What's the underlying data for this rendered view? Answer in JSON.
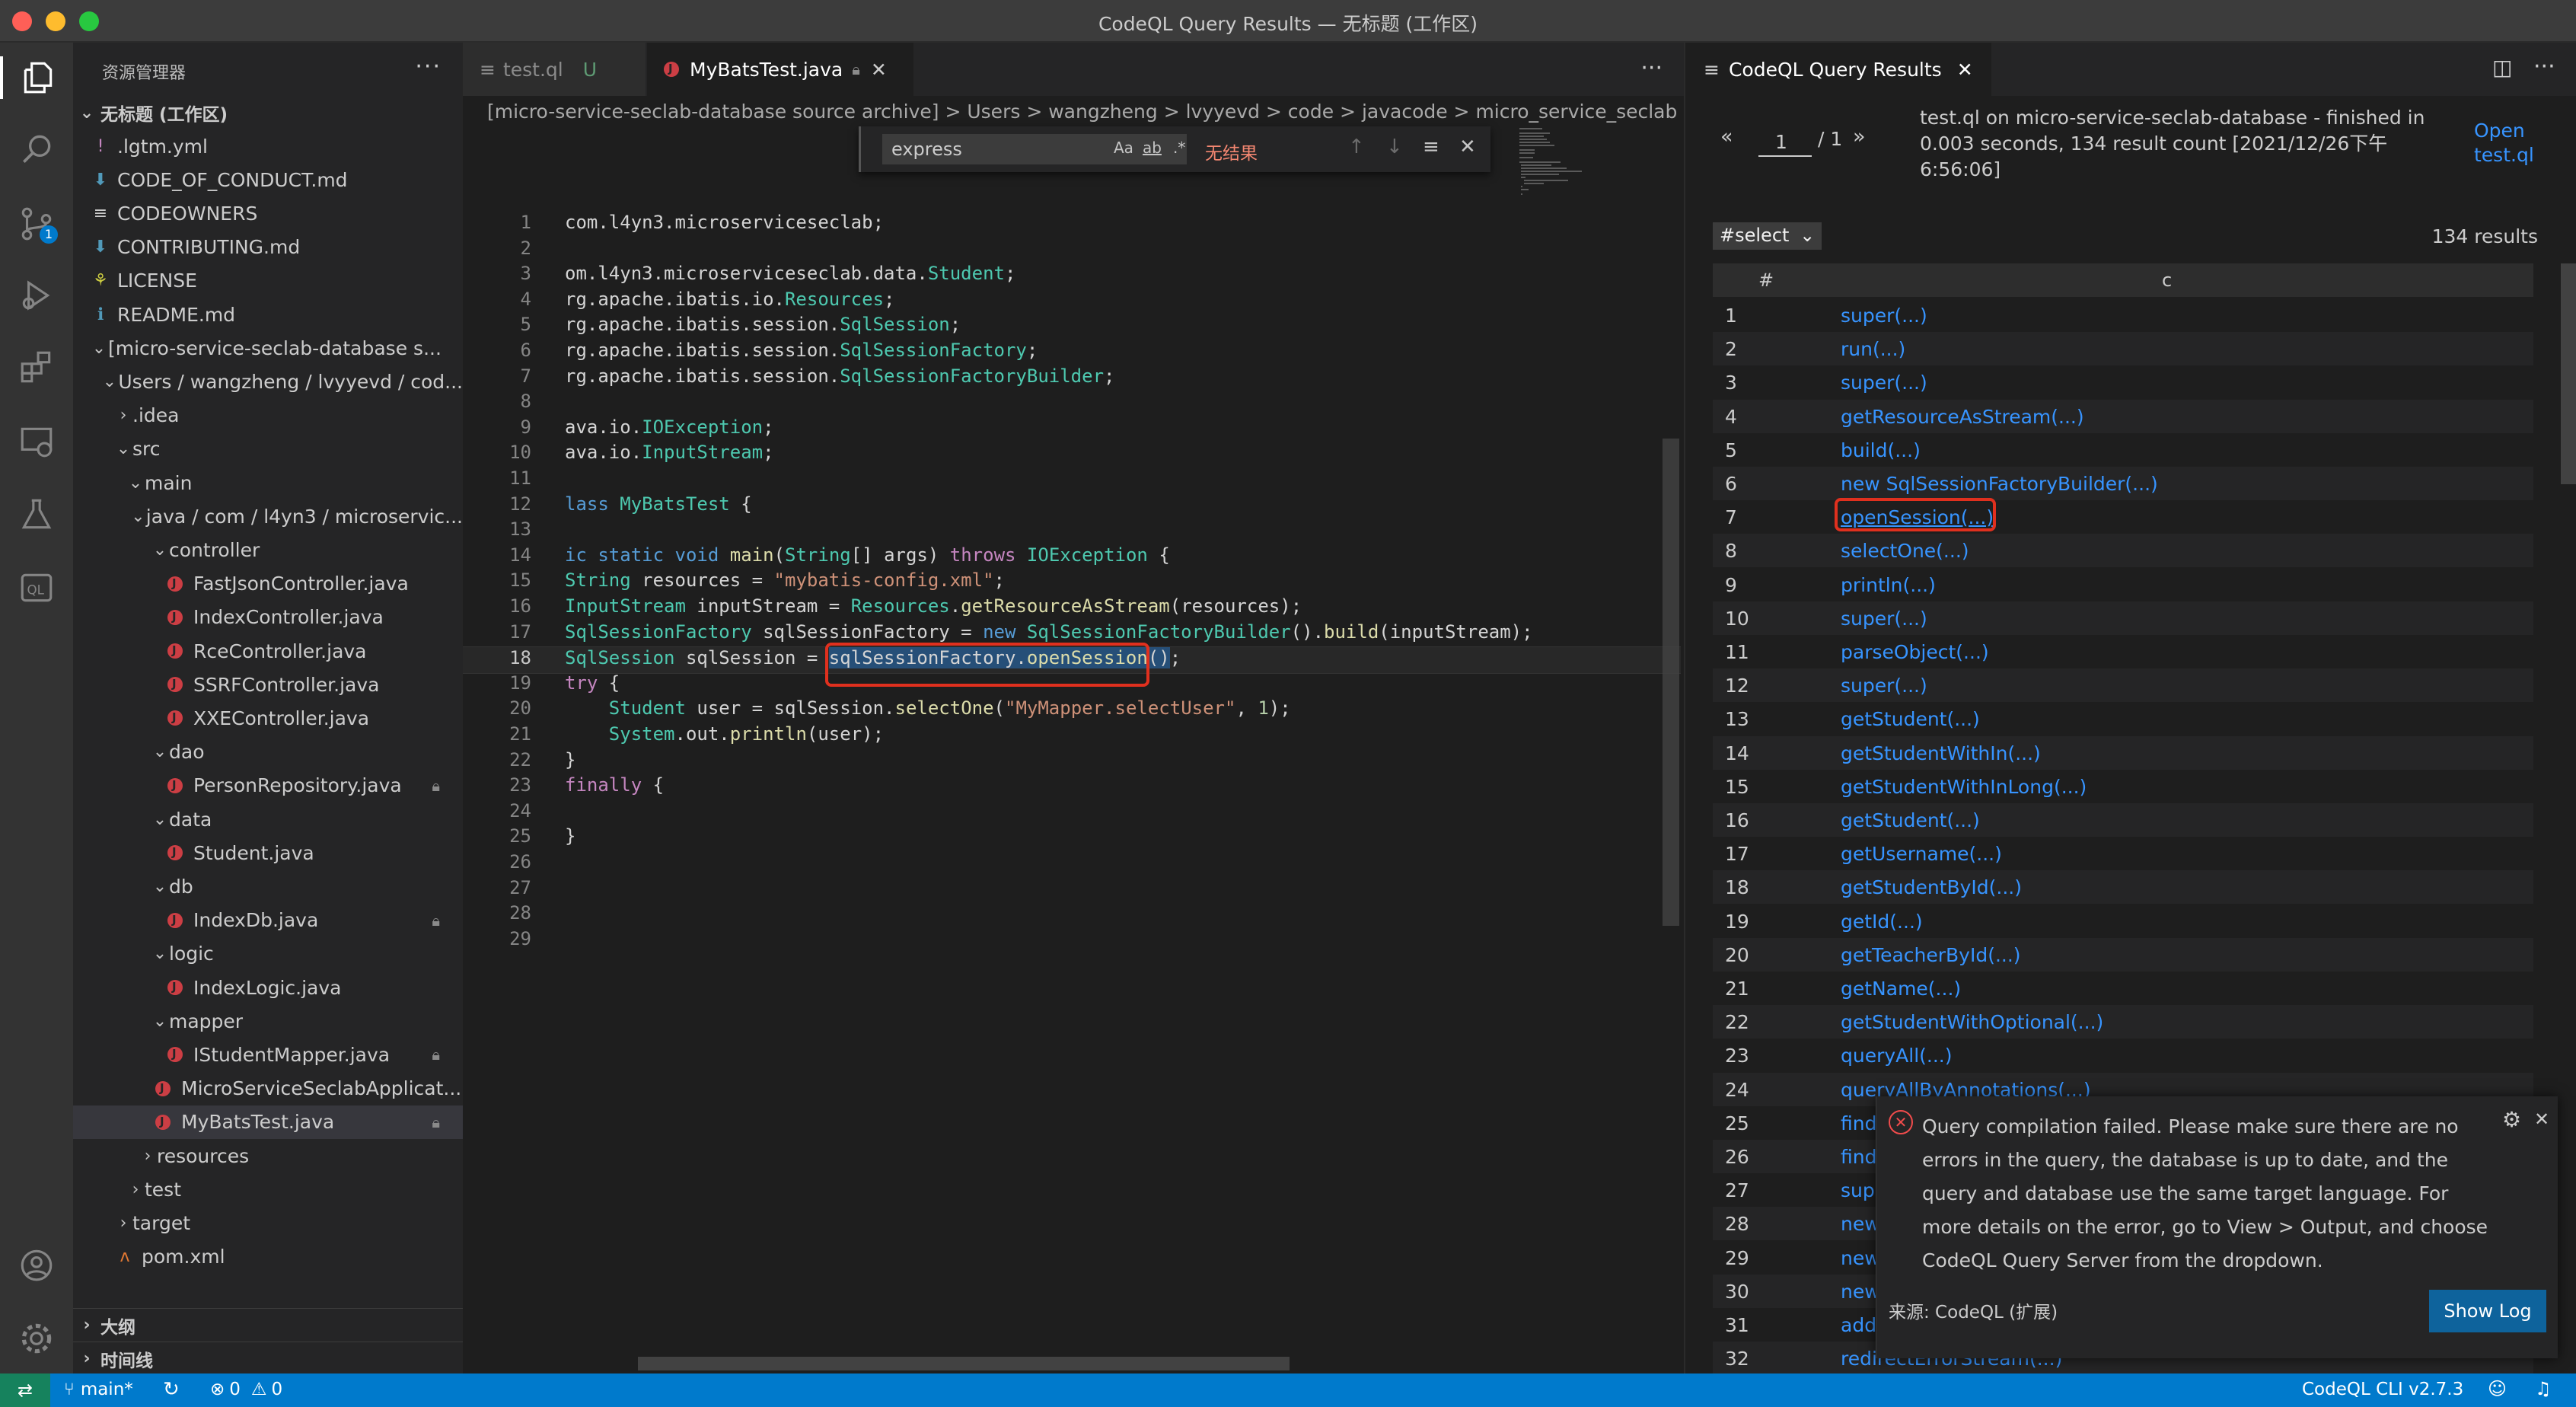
{
  "window": {
    "title": "CodeQL Query Results — 无标题 (工作区)"
  },
  "explorer": {
    "title": "资源管理器",
    "more": "···",
    "items": [
      {
        "label": ".lgtm.yml",
        "icon": "!",
        "icon_color": "#c586c0"
      },
      {
        "label": "CODE_OF_CONDUCT.md",
        "icon": "⬇",
        "icon_color": "#519aba"
      },
      {
        "label": "CODEOWNERS",
        "icon": "≡",
        "icon_color": "#cccccc"
      },
      {
        "label": "CONTRIBUTING.md",
        "icon": "⬇",
        "icon_color": "#519aba"
      },
      {
        "label": "LICENSE",
        "icon": "⚘",
        "icon_color": "#cbcb41"
      },
      {
        "label": "README.md",
        "icon": "ℹ",
        "icon_color": "#519aba"
      },
      {
        "label": "[micro-service-seclab-database s..."
      },
      {
        "label": "Users / wangzheng / lvyyevd / cod..."
      },
      {
        "label": ".idea"
      },
      {
        "label": "src"
      },
      {
        "label": "main"
      },
      {
        "label": "java / com / l4yn3 / microservic..."
      },
      {
        "label": "controller"
      },
      {
        "label": "FastJsonController.java"
      },
      {
        "label": "IndexController.java"
      },
      {
        "label": "RceController.java"
      },
      {
        "label": "SSRFController.java"
      },
      {
        "label": "XXEController.java"
      },
      {
        "label": "dao"
      },
      {
        "label": "PersonRepository.java"
      },
      {
        "label": "data"
      },
      {
        "label": "Student.java"
      },
      {
        "label": "db"
      },
      {
        "label": "IndexDb.java"
      },
      {
        "label": "logic"
      },
      {
        "label": "IndexLogic.java"
      },
      {
        "label": "mapper"
      },
      {
        "label": "IStudentMapper.java"
      },
      {
        "label": "MicroServiceSeclabApplicat..."
      },
      {
        "label": "MyBatsTest.java"
      },
      {
        "label": "resources"
      },
      {
        "label": "test"
      },
      {
        "label": "target"
      },
      {
        "label": "pom.xml"
      }
    ],
    "workspace_label": "无标题 (工作区)",
    "outline_label": "大纲",
    "timeline_label": "时间线"
  },
  "editor": {
    "tabs": [
      {
        "label": "test.ql",
        "badge": "U"
      },
      {
        "label": "MyBatsTest.java"
      }
    ],
    "more": "···",
    "breadcrumb": "[micro-service-seclab-database source archive]  >  Users  >  wangzheng  >  lvyyevd  >  code  >  javacode  >  micro_service_seclab  >  src",
    "find": {
      "value": "express",
      "case_label": "Aa",
      "word_label": "ab",
      "regex_label": ".*",
      "no_results": "无结果"
    },
    "lines": [
      {
        "n": "1",
        "t": "com.l4yn3.microserviceseclab;"
      },
      {
        "n": "2",
        "t": ""
      },
      {
        "n": "3",
        "t": "om.l4yn3.microserviceseclab.data.Student;"
      },
      {
        "n": "4",
        "t": "rg.apache.ibatis.io.Resources;"
      },
      {
        "n": "5",
        "t": "rg.apache.ibatis.session.SqlSession;"
      },
      {
        "n": "6",
        "t": "rg.apache.ibatis.session.SqlSessionFactory;"
      },
      {
        "n": "7",
        "t": "rg.apache.ibatis.session.SqlSessionFactoryBuilder;"
      },
      {
        "n": "8",
        "t": ""
      },
      {
        "n": "9",
        "t": "ava.io.IOException;"
      },
      {
        "n": "10",
        "t": "ava.io.InputStream;"
      },
      {
        "n": "11",
        "t": ""
      },
      {
        "n": "12",
        "t": "lass MyBatsTest {"
      },
      {
        "n": "13",
        "t": ""
      },
      {
        "n": "14",
        "t": "ic static void main(String[] args) throws IOException {"
      },
      {
        "n": "15",
        "t": "String resources = \"mybatis-config.xml\";"
      },
      {
        "n": "16",
        "t": "InputStream inputStream = Resources.getResourceAsStream(resources);"
      },
      {
        "n": "17",
        "t": "SqlSessionFactory sqlSessionFactory = new SqlSessionFactoryBuilder().build(inputStream);"
      },
      {
        "n": "18",
        "t": "SqlSession sqlSession = sqlSessionFactory.openSession();"
      },
      {
        "n": "19",
        "t": "try {"
      },
      {
        "n": "20",
        "t": "    Student user = sqlSession.selectOne(\"MyMapper.selectUser\", 1);"
      },
      {
        "n": "21",
        "t": "    System.out.println(user);"
      },
      {
        "n": "22",
        "t": "}"
      },
      {
        "n": "23",
        "t": "finally {"
      },
      {
        "n": "24",
        "t": ""
      },
      {
        "n": "25",
        "t": "}"
      },
      {
        "n": "26",
        "t": ""
      },
      {
        "n": "27",
        "t": ""
      },
      {
        "n": "28",
        "t": ""
      },
      {
        "n": "29",
        "t": ""
      }
    ],
    "highlighted_expression": "sqlSessionFactory.openSession()"
  },
  "results": {
    "tab_label": "CodeQL Query Results",
    "page_current": "1",
    "page_total": "/ 1",
    "prev": "«",
    "next": "»",
    "summary": "test.ql on micro-service-seclab-database - finished in 0.003 seconds, 134 result count [2021/12/26下午6:56:06]",
    "open_link": "Open test.ql",
    "select_value": "#select",
    "count_label": "134 results",
    "col_index": "#",
    "col_c": "c",
    "rows": [
      {
        "n": "1",
        "c": "super(...)"
      },
      {
        "n": "2",
        "c": "run(...)"
      },
      {
        "n": "3",
        "c": "super(...)"
      },
      {
        "n": "4",
        "c": "getResourceAsStream(...)"
      },
      {
        "n": "5",
        "c": "build(...)"
      },
      {
        "n": "6",
        "c": "new SqlSessionFactoryBuilder(...)"
      },
      {
        "n": "7",
        "c": "openSession(...)"
      },
      {
        "n": "8",
        "c": "selectOne(...)"
      },
      {
        "n": "9",
        "c": "println(...)"
      },
      {
        "n": "10",
        "c": "super(...)"
      },
      {
        "n": "11",
        "c": "parseObject(...)"
      },
      {
        "n": "12",
        "c": "super(...)"
      },
      {
        "n": "13",
        "c": "getStudent(...)"
      },
      {
        "n": "14",
        "c": "getStudentWithIn(...)"
      },
      {
        "n": "15",
        "c": "getStudentWithInLong(...)"
      },
      {
        "n": "16",
        "c": "getStudent(...)"
      },
      {
        "n": "17",
        "c": "getUsername(...)"
      },
      {
        "n": "18",
        "c": "getStudentById(...)"
      },
      {
        "n": "19",
        "c": "getId(...)"
      },
      {
        "n": "20",
        "c": "getTeacherById(...)"
      },
      {
        "n": "21",
        "c": "getName(...)"
      },
      {
        "n": "22",
        "c": "getStudentWithOptional(...)"
      },
      {
        "n": "23",
        "c": "queryAll(...)"
      },
      {
        "n": "24",
        "c": "queryAllByAnnotations(...)"
      },
      {
        "n": "25",
        "c": "find"
      },
      {
        "n": "26",
        "c": "find"
      },
      {
        "n": "27",
        "c": "supe"
      },
      {
        "n": "28",
        "c": "new"
      },
      {
        "n": "29",
        "c": "new"
      },
      {
        "n": "30",
        "c": "new"
      },
      {
        "n": "31",
        "c": "add"
      },
      {
        "n": "32",
        "c": "redirectErrorStream(...)"
      }
    ]
  },
  "notification": {
    "message": "Query compilation failed. Please make sure there are no errors in the query, the database is up to date, and the query and database use the same target language. For more details on the error, go to View > Output, and choose CodeQL Query Server from the dropdown.",
    "source": "来源: CodeQL (扩展)",
    "button": "Show Log"
  },
  "status": {
    "branch": "main*",
    "problems": "0",
    "warnings": "0",
    "cli": "CodeQL CLI v2.7.3"
  },
  "colors": {
    "accent": "#007acc",
    "link": "#3794ff",
    "highlight_box": "#e0301e"
  }
}
